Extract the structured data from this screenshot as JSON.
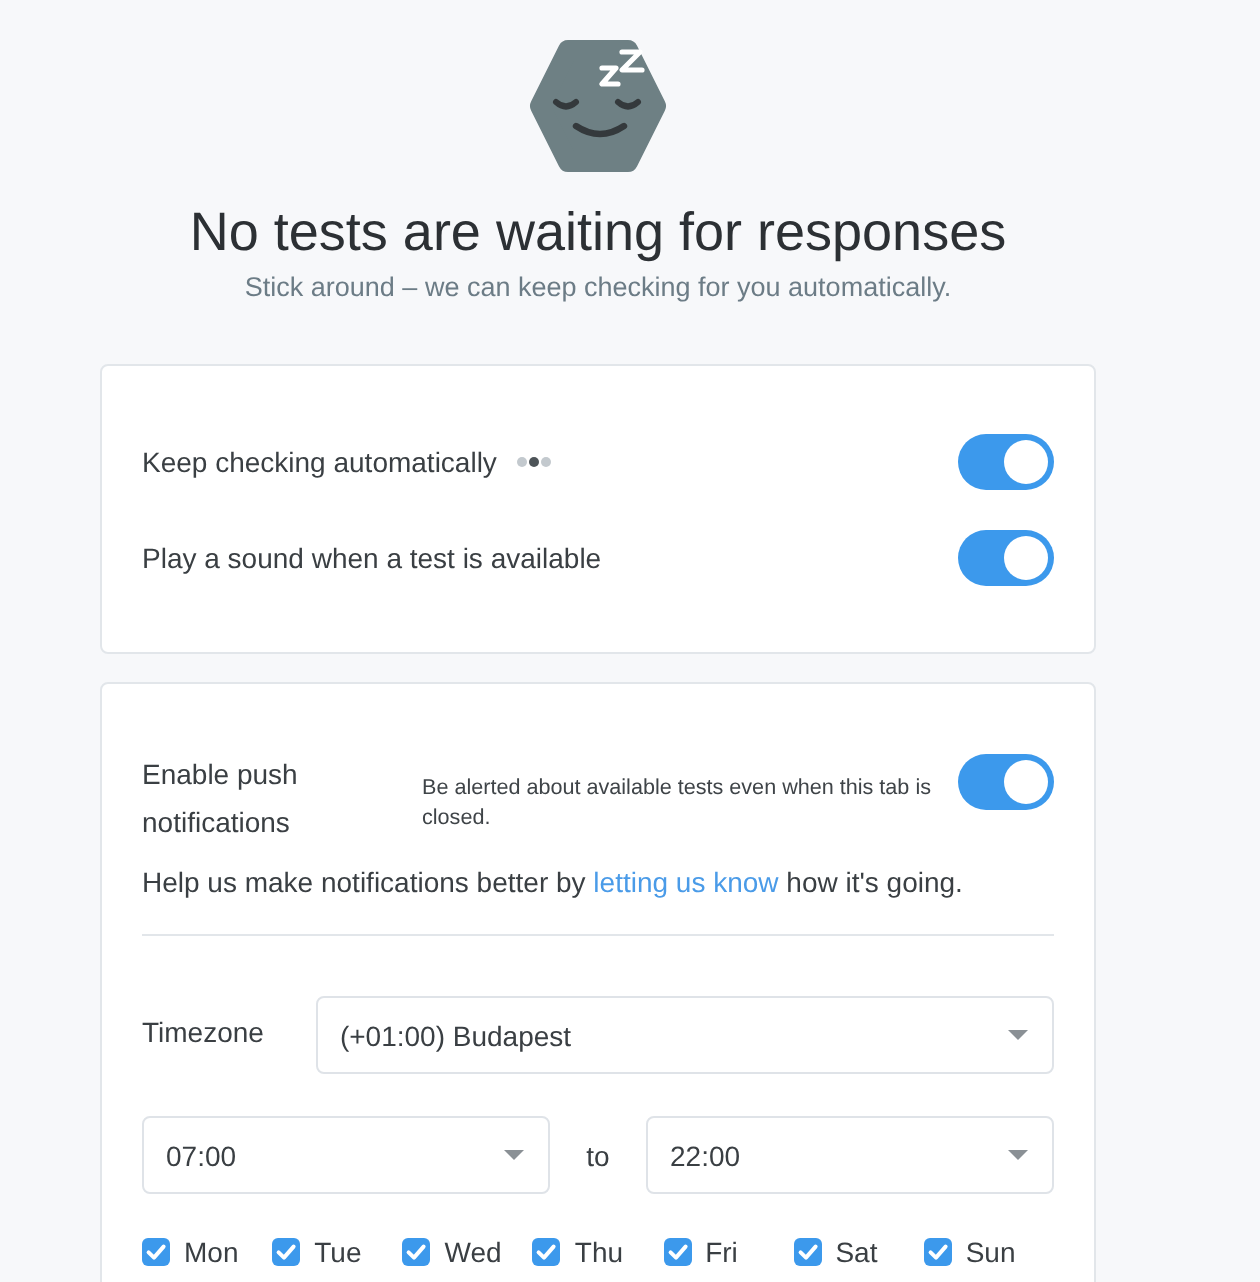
{
  "heading": "No tests are waiting for responses",
  "subheading": "Stick around – we can keep checking for you automatically.",
  "general_settings": [
    {
      "label": "Keep checking automatically",
      "busy": true,
      "on": true
    },
    {
      "label": "Play a sound when a test is available",
      "busy": false,
      "on": true
    }
  ],
  "push_notifications": {
    "label": "Enable push notifications",
    "description": "Be alerted about available tests even when this tab is closed.",
    "on": true,
    "feedback": {
      "before": "Help us make notifications better by",
      "link": "letting us know",
      "after": "how it's going."
    }
  },
  "schedule": {
    "timezone_label": "Timezone",
    "timezone": "(+01:00) Budapest",
    "start": "07:00",
    "separator": "to",
    "end": "22:00",
    "days": [
      {
        "label": "Mon",
        "checked": true
      },
      {
        "label": "Tue",
        "checked": true
      },
      {
        "label": "Wed",
        "checked": true
      },
      {
        "label": "Thu",
        "checked": true
      },
      {
        "label": "Fri",
        "checked": true
      },
      {
        "label": "Sat",
        "checked": true
      },
      {
        "label": "Sun",
        "checked": true
      }
    ]
  }
}
